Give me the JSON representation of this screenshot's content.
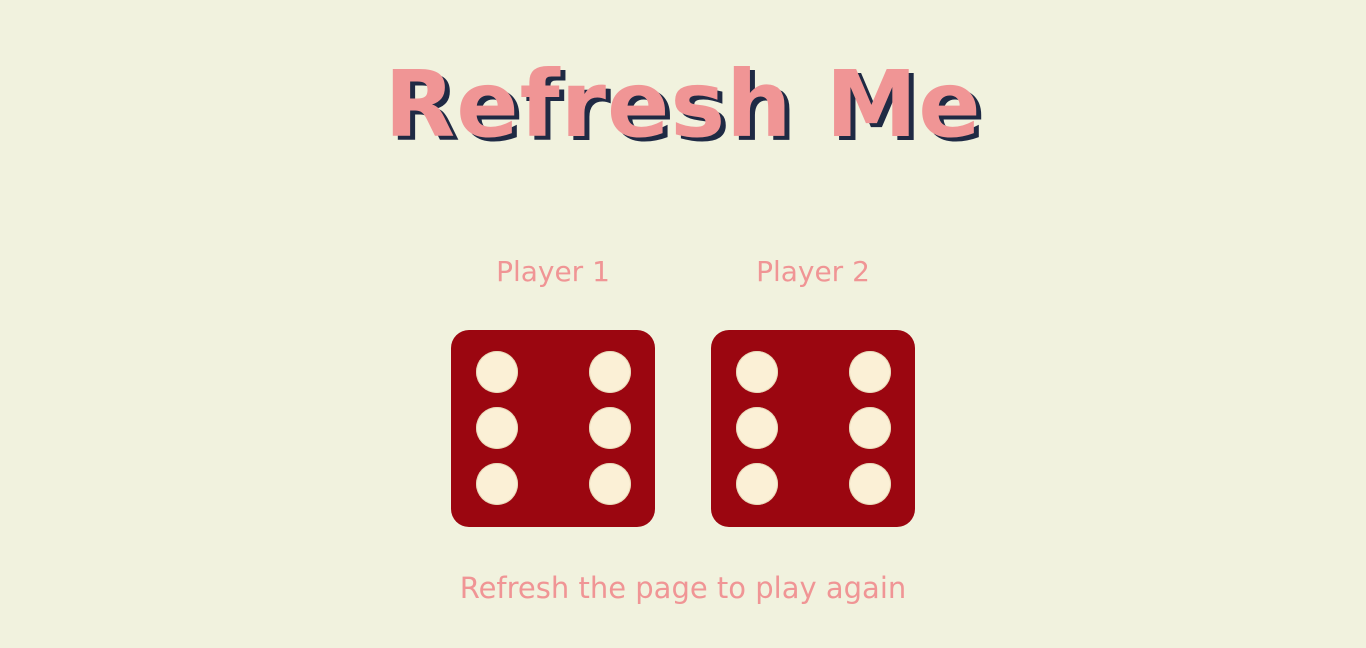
{
  "title": "Refresh Me",
  "players": [
    {
      "label": "Player 1",
      "die_value": 6
    },
    {
      "label": "Player 2",
      "die_value": 6
    }
  ],
  "hint": "Refresh the page to play again",
  "colors": {
    "background": "#f1f2de",
    "accent": "#f09595",
    "title_shadow": "#1f2a44",
    "die_face": "#9b0610",
    "pip": "#fbf0d6"
  }
}
